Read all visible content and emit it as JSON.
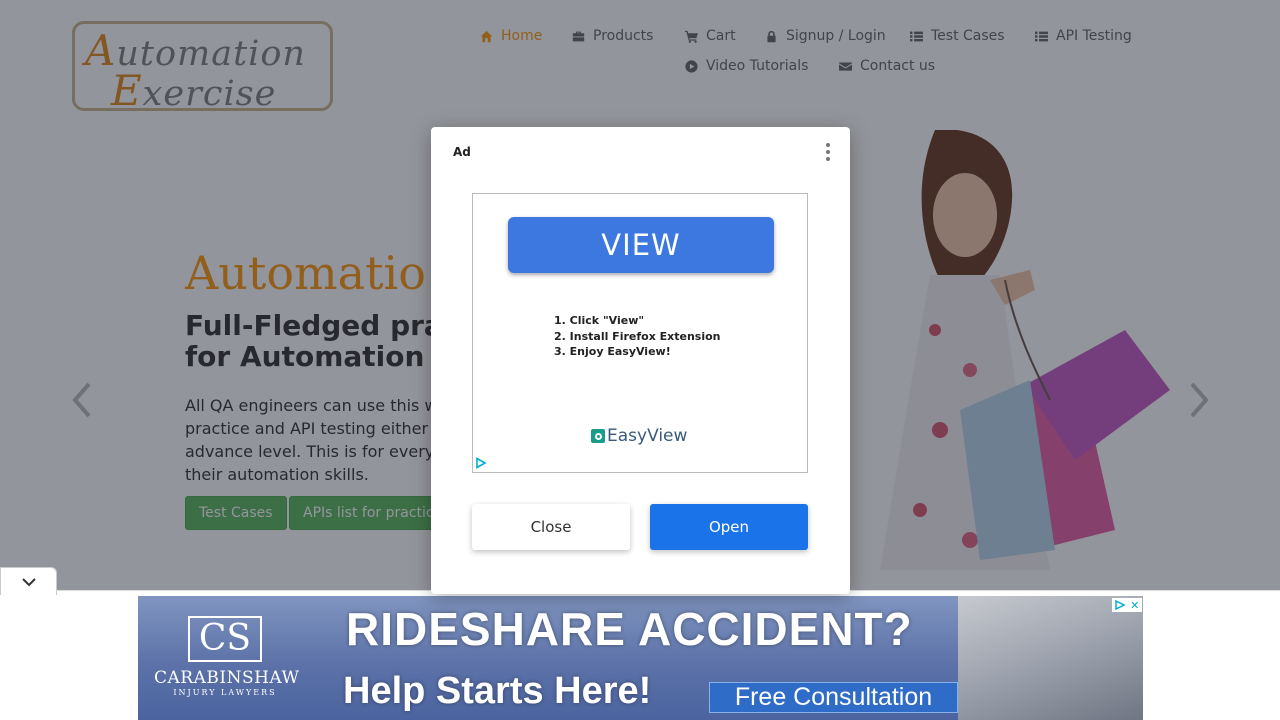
{
  "header": {
    "logo_line1_cap": "A",
    "logo_line1_rest": "utomation",
    "logo_line2_cap": "E",
    "logo_line2_rest": "xercise",
    "nav": [
      {
        "label": "Home",
        "icon": "home-icon",
        "active": true
      },
      {
        "label": "Products",
        "icon": "briefcase-icon"
      },
      {
        "label": "Cart",
        "icon": "cart-icon"
      },
      {
        "label": "Signup / Login",
        "icon": "lock-icon"
      },
      {
        "label": "Test Cases",
        "icon": "list-icon"
      },
      {
        "label": "API Testing",
        "icon": "list-icon"
      },
      {
        "label": "Video Tutorials",
        "icon": "youtube-icon"
      },
      {
        "label": "Contact us",
        "icon": "envelope-icon"
      }
    ]
  },
  "hero": {
    "title": "Automatio",
    "subtitle_line1": "Full-Fledged pra",
    "subtitle_line2": "for Automation",
    "text_line1": "All QA engineers can use this w",
    "text_line2": "practice and API testing either",
    "text_line3": "advance level. This is for every",
    "text_line4": "their automation skills.",
    "btn_test_cases": "Test Cases",
    "btn_apis": "APIs list for practic"
  },
  "modal": {
    "ad_label": "Ad",
    "view_label": "VIEW",
    "steps": [
      "1. Click \"View\"",
      "2. Install Firefox Extension",
      "3. Enjoy EasyView!"
    ],
    "brand": "EasyView",
    "close_label": "Close",
    "open_label": "Open"
  },
  "banner": {
    "logo_mark": "CS",
    "logo_name": "CARABINSHAW",
    "logo_tag": "INJURY LAWYERS",
    "headline": "RIDESHARE ACCIDENT?",
    "subline": "Help Starts Here!",
    "cta": "Free Consultation",
    "adchoices_close": "✕"
  },
  "colors": {
    "accent": "#fe980f",
    "green_button": "#5cb85c",
    "open_button": "#1a73e8",
    "view_button": "#3c78e0"
  }
}
